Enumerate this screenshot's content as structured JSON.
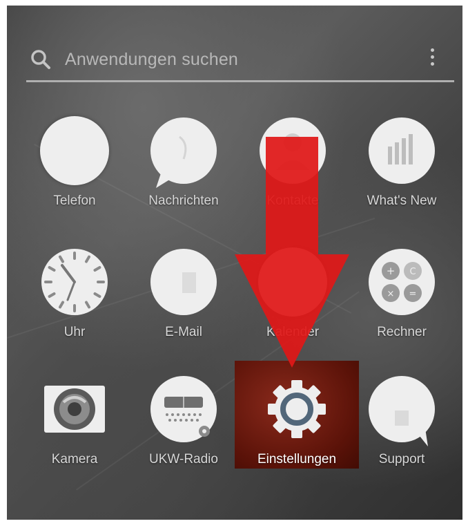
{
  "search": {
    "placeholder": "Anwendungen suchen"
  },
  "apps": [
    {
      "label": "Telefon",
      "icon": "phone-icon"
    },
    {
      "label": "Nachrichten",
      "icon": "messages-icon"
    },
    {
      "label": "Kontakte",
      "icon": "contacts-icon"
    },
    {
      "label": "What's New",
      "icon": "whats-new-icon"
    },
    {
      "label": "Uhr",
      "icon": "clock-icon"
    },
    {
      "label": "E-Mail",
      "icon": "email-icon"
    },
    {
      "label": "Kalender",
      "icon": "calendar-icon"
    },
    {
      "label": "Rechner",
      "icon": "calculator-icon"
    },
    {
      "label": "Kamera",
      "icon": "camera-icon"
    },
    {
      "label": "UKW-Radio",
      "icon": "radio-icon"
    },
    {
      "label": "Einstellungen",
      "icon": "settings-gear-icon"
    },
    {
      "label": "Support",
      "icon": "support-icon"
    }
  ],
  "colors": {
    "highlight": "#6a1a0e",
    "arrow": "#e01818",
    "gear": "#52677a"
  }
}
